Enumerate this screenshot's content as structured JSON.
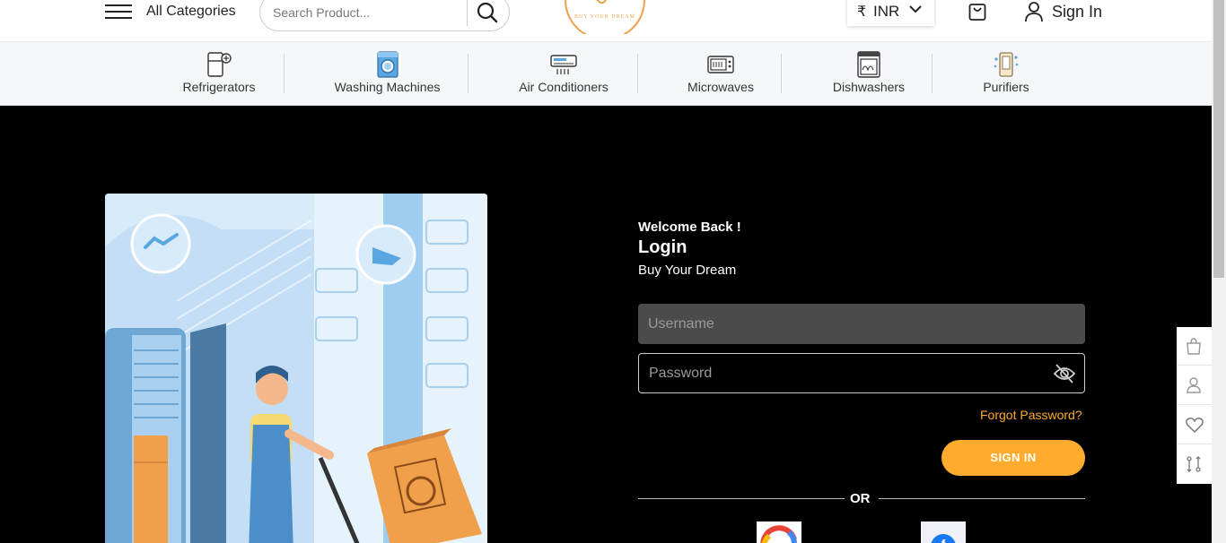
{
  "header": {
    "all_categories_label": "All Categories",
    "search_placeholder": "Search Product...",
    "logo_text": "BUY YOUR DREAM",
    "currency_symbol": "₹",
    "currency_code": "INR",
    "sign_in_label": "Sign In"
  },
  "categories": [
    {
      "label": "Refrigerators",
      "icon": "refrigerator-icon"
    },
    {
      "label": "Washing Machines",
      "icon": "washing-machine-icon"
    },
    {
      "label": "Air Conditioners",
      "icon": "air-conditioner-icon"
    },
    {
      "label": "Microwaves",
      "icon": "microwave-icon"
    },
    {
      "label": "Dishwashers",
      "icon": "dishwasher-icon"
    },
    {
      "label": "Purifiers",
      "icon": "purifier-icon"
    }
  ],
  "login": {
    "welcome": "Welcome Back !",
    "title": "Login",
    "tagline": "Buy Your Dream",
    "username_placeholder": "Username",
    "password_placeholder": "Password",
    "forgot_label": "Forgot Password?",
    "sign_in_button": "SIGN IN",
    "or_label": "OR"
  },
  "float_panel": [
    "cart-icon",
    "user-icon",
    "heart-icon",
    "compare-icon"
  ],
  "colors": {
    "accent": "#ffab2e",
    "background": "#000000",
    "header_bg": "#ffffff",
    "category_bar_bg": "#f5f7fa",
    "username_field_bg": "#4b4b4b"
  }
}
